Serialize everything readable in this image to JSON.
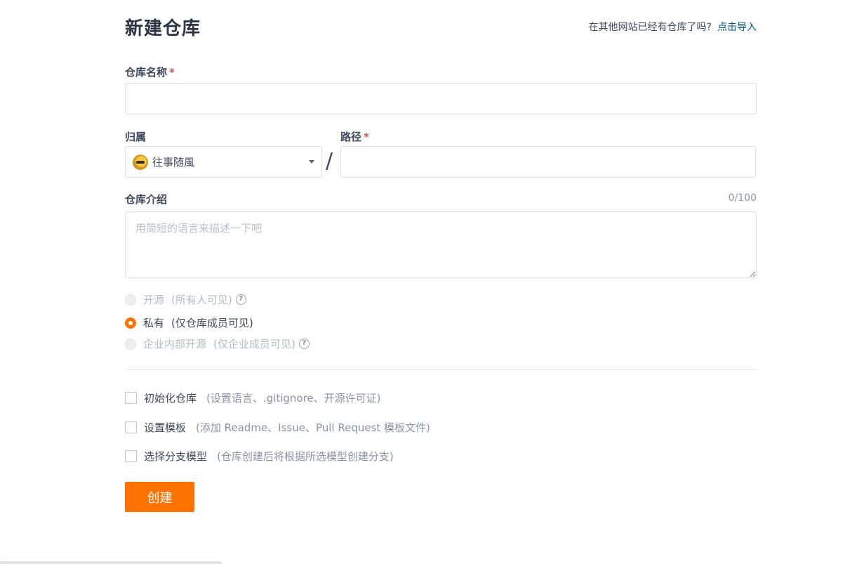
{
  "header": {
    "title": "新建仓库",
    "import_question": "在其他网站已经有仓库了吗?",
    "import_link": "点击导入"
  },
  "form": {
    "repo_name_label": "仓库名称",
    "required_mark": "*",
    "repo_name_value": "",
    "owner_label": "归属",
    "owner_value": "往事随風",
    "path_label": "路径",
    "path_value": "",
    "path_separator": "/",
    "description_label": "仓库介绍",
    "description_counter": "0/100",
    "description_placeholder": "用简短的语言来描述一下吧"
  },
  "visibility": {
    "options": [
      {
        "label": "开源",
        "hint": "(所有人可见)",
        "state": "disabled",
        "help_icon": "question-circle-icon"
      },
      {
        "label": "私有",
        "hint": "(仅仓库成员可见)",
        "state": "checked"
      },
      {
        "label": "企业内部开源",
        "hint": "(仅企业成员可见)",
        "state": "disabled",
        "help_icon": "question-circle-icon"
      }
    ],
    "help_glyph": "?"
  },
  "extras": {
    "items": [
      {
        "label": "初始化仓库",
        "hint": "(设置语言、.gitignore、开源许可证)",
        "checked": false
      },
      {
        "label": "设置模板",
        "hint": "(添加 Readme、Issue、Pull Request 模板文件)",
        "checked": false
      },
      {
        "label": "选择分支模型",
        "hint": "(仓库创建后将根据所选模型创建分支)",
        "checked": false
      }
    ]
  },
  "actions": {
    "create_label": "创建"
  },
  "colors": {
    "accent": "#fe7300",
    "link": "#005980",
    "required": "#d9534f"
  }
}
